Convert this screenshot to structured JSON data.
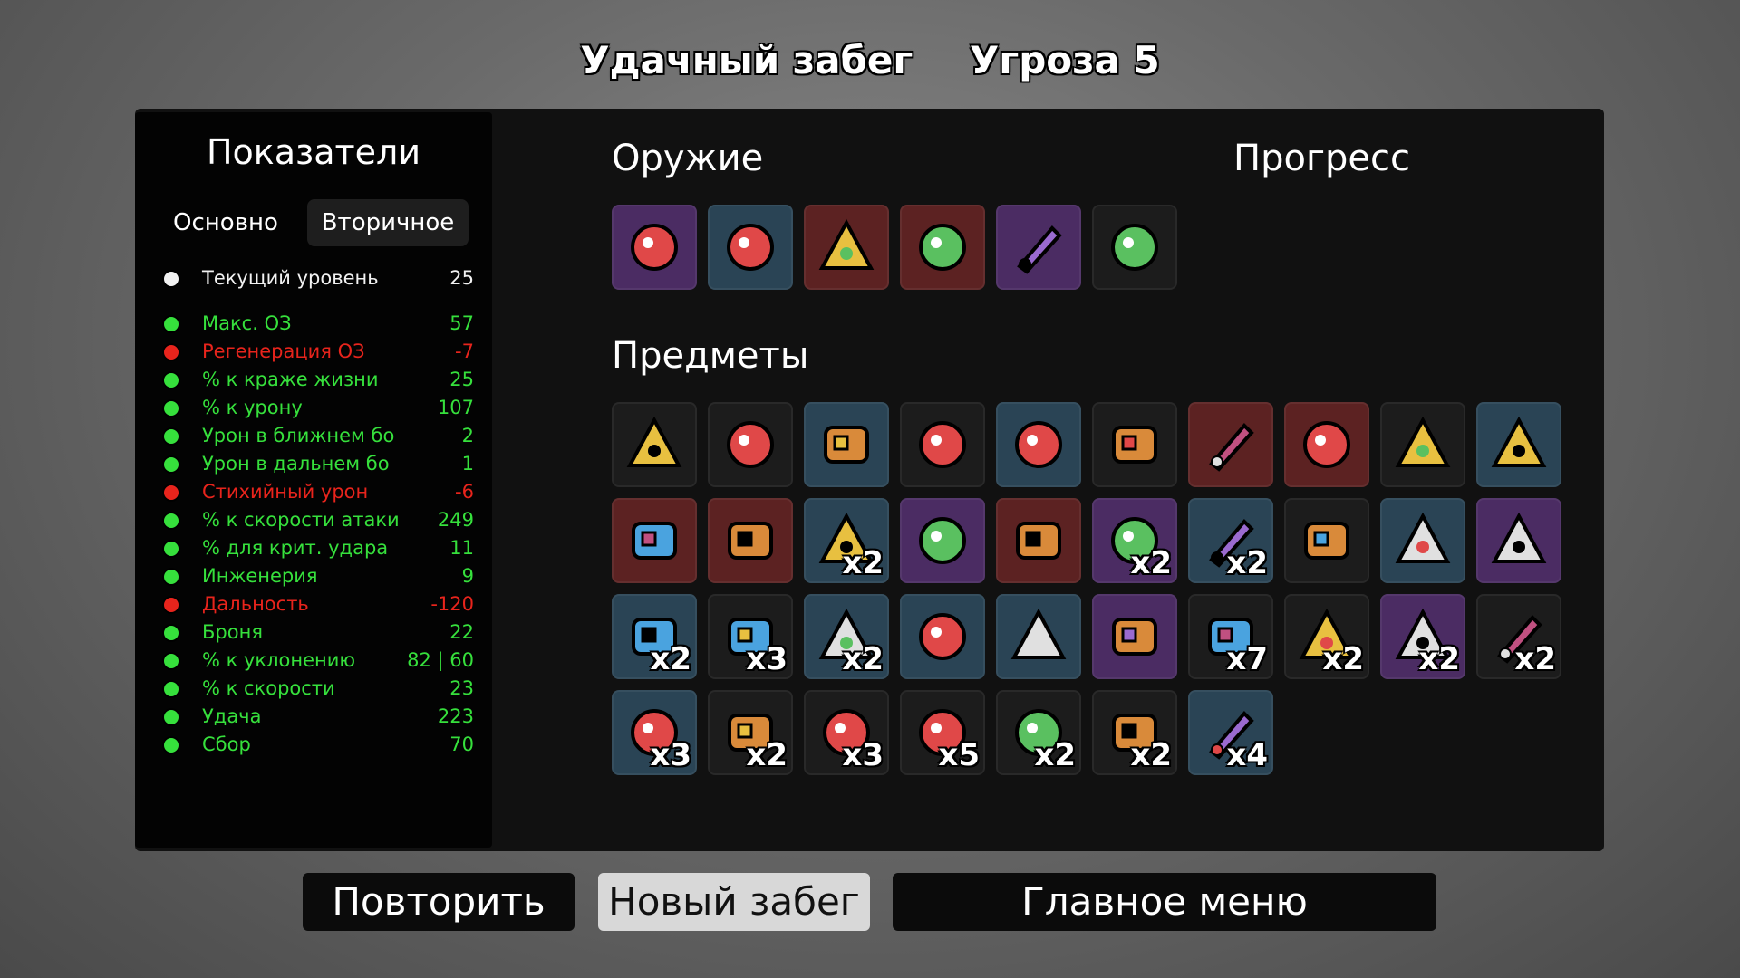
{
  "header": {
    "run_result": "Удачный забег",
    "danger": "Угроза 5"
  },
  "stats": {
    "title": "Показатели",
    "tabs": {
      "main": "Основно",
      "secondary": "Вторичное"
    },
    "rows": [
      {
        "icon": "level-up-icon",
        "color": "#f2f2f2",
        "label": "Текущий уровень",
        "value": "25"
      },
      {
        "icon": "heart-icon",
        "color": "#36e03c",
        "label": "Макс. ОЗ",
        "value": "57"
      },
      {
        "icon": "heart-plus-icon",
        "color": "#e8241c",
        "label": "Регенерация ОЗ",
        "value": "-7"
      },
      {
        "icon": "fangs-icon",
        "color": "#36e03c",
        "label": "% к краже жизни",
        "value": "25"
      },
      {
        "icon": "muscle-icon",
        "color": "#36e03c",
        "label": "% к урону",
        "value": "107"
      },
      {
        "icon": "sword-icon",
        "color": "#36e03c",
        "label": "Урон в ближнем бо",
        "value": "2"
      },
      {
        "icon": "bow-icon",
        "color": "#36e03c",
        "label": "Урон в дальнем бо",
        "value": "1"
      },
      {
        "icon": "fire-icon",
        "color": "#e8241c",
        "label": "Стихийный урон",
        "value": "-6"
      },
      {
        "icon": "hourglass-icon",
        "color": "#36e03c",
        "label": "% к скорости атаки",
        "value": "249"
      },
      {
        "icon": "crit-burst-icon",
        "color": "#36e03c",
        "label": "% для крит. удара",
        "value": "11"
      },
      {
        "icon": "wrench-icon",
        "color": "#36e03c",
        "label": "Инженерия",
        "value": "9"
      },
      {
        "icon": "range-waves-icon",
        "color": "#e8241c",
        "label": "Дальность",
        "value": "-120"
      },
      {
        "icon": "shield-icon",
        "color": "#36e03c",
        "label": "Броня",
        "value": "22"
      },
      {
        "icon": "dodge-wind-icon",
        "color": "#36e03c",
        "label": "% к уклонению",
        "value": "82 | 60"
      },
      {
        "icon": "boot-icon",
        "color": "#36e03c",
        "label": "% к скорости",
        "value": "23"
      },
      {
        "icon": "dice-icon",
        "color": "#36e03c",
        "label": "Удача",
        "value": "223"
      },
      {
        "icon": "harvest-icon",
        "color": "#36e03c",
        "label": "Сбор",
        "value": "70"
      }
    ]
  },
  "weapons": {
    "title": "Оружие",
    "list": [
      {
        "icon": "dragon-gun-icon",
        "tier": "purple"
      },
      {
        "icon": "blaster-icon",
        "tier": "blue"
      },
      {
        "icon": "lightning-spear-icon",
        "tier": "red"
      },
      {
        "icon": "megaphone-gun-icon",
        "tier": "red"
      },
      {
        "icon": "sword-icon",
        "tier": "purple"
      },
      {
        "icon": "blaster-icon",
        "tier": "dark"
      }
    ]
  },
  "progress": {
    "title": "Прогресс"
  },
  "items": {
    "title": "Предметы",
    "list": [
      {
        "icon": "panda-face-icon",
        "tier": "dark",
        "qty": ""
      },
      {
        "icon": "screaming-mouth-icon",
        "tier": "dark",
        "qty": ""
      },
      {
        "icon": "snail-icon",
        "tier": "blue",
        "qty": ""
      },
      {
        "icon": "ghost-knight-icon",
        "tier": "dark",
        "qty": ""
      },
      {
        "icon": "stone-slab-icon",
        "tier": "blue",
        "qty": ""
      },
      {
        "icon": "rubber-duck-icon",
        "tier": "dark",
        "qty": ""
      },
      {
        "icon": "potato-icon",
        "tier": "red",
        "qty": ""
      },
      {
        "icon": "red-cape-icon",
        "tier": "red",
        "qty": ""
      },
      {
        "icon": "bandaged-face-icon",
        "tier": "dark",
        "qty": ""
      },
      {
        "icon": "stone-crown-icon",
        "tier": "blue",
        "qty": ""
      },
      {
        "icon": "anvil-icon",
        "tier": "red",
        "qty": ""
      },
      {
        "icon": "robot-arm-icon",
        "tier": "red",
        "qty": ""
      },
      {
        "icon": "scroll-icon",
        "tier": "blue",
        "qty": "x2"
      },
      {
        "icon": "angel-wings-icon",
        "tier": "purple",
        "qty": ""
      },
      {
        "icon": "red-hoodie-icon",
        "tier": "red",
        "qty": ""
      },
      {
        "icon": "white-rabbit-icon",
        "tier": "purple",
        "qty": "x2"
      },
      {
        "icon": "black-beret-icon",
        "tier": "blue",
        "qty": "x2"
      },
      {
        "icon": "skull-ghost-icon",
        "tier": "dark",
        "qty": ""
      },
      {
        "icon": "lamp-arm-icon",
        "tier": "blue",
        "qty": ""
      },
      {
        "icon": "blue-fin-icon",
        "tier": "purple",
        "qty": ""
      },
      {
        "icon": "red-coil-icon",
        "tier": "blue",
        "qty": "x2"
      },
      {
        "icon": "propeller-cap-icon",
        "tier": "dark",
        "qty": "x3"
      },
      {
        "icon": "potion-bottle-icon",
        "tier": "blue",
        "qty": "x2"
      },
      {
        "icon": "cocoon-icon",
        "tier": "blue",
        "qty": ""
      },
      {
        "icon": "amulet-icon",
        "tier": "blue",
        "qty": ""
      },
      {
        "icon": "eraser-icon",
        "tier": "purple",
        "qty": ""
      },
      {
        "icon": "bonsai-tree-icon",
        "tier": "dark",
        "qty": "x7"
      },
      {
        "icon": "honey-jar-icon",
        "tier": "dark",
        "qty": "x2"
      },
      {
        "icon": "cat-icon",
        "tier": "purple",
        "qty": "x2"
      },
      {
        "icon": "sack-icon",
        "tier": "dark",
        "qty": "x2"
      },
      {
        "icon": "worm-icon",
        "tier": "blue",
        "qty": "x3"
      },
      {
        "icon": "syringe-icon",
        "tier": "dark",
        "qty": "x2"
      },
      {
        "icon": "helmet-icon",
        "tier": "dark",
        "qty": "x3"
      },
      {
        "icon": "alien-map-icon",
        "tier": "dark",
        "qty": "x5"
      },
      {
        "icon": "red-claw-icon",
        "tier": "dark",
        "qty": "x2"
      },
      {
        "icon": "hedgehog-icon",
        "tier": "dark",
        "qty": "x2"
      },
      {
        "icon": "bunny-icon",
        "tier": "blue",
        "qty": "x4"
      }
    ]
  },
  "buttons": {
    "retry": "Повторить",
    "new_run": "Новый забег",
    "main_menu": "Главное меню"
  }
}
